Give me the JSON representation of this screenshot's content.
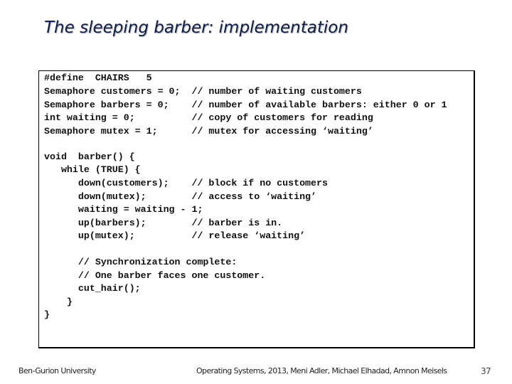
{
  "slide": {
    "title": "The sleeping barber: implementation",
    "code_lines": [
      "#define  CHAIRS   5",
      "Semaphore customers = 0;  // number of waiting customers",
      "Semaphore barbers = 0;    // number of available barbers: either 0 or 1",
      "int waiting = 0;          // copy of customers for reading",
      "Semaphore mutex = 1;      // mutex for accessing ‘waiting’",
      "",
      "void  barber() {",
      "   while (TRUE) {",
      "      down(customers);    // block if no customers",
      "      down(mutex);        // access to ‘waiting’",
      "      waiting = waiting - 1;",
      "      up(barbers);        // barber is in.",
      "      up(mutex);          // release ‘waiting’",
      "",
      "      // Synchronization complete:",
      "      // One barber faces one customer.",
      "      cut_hair();",
      "    }",
      "}"
    ],
    "footer": {
      "left": "Ben-Gurion University",
      "center": "Operating Systems, 2013, Meni Adler, Michael Elhadad, Amnon Meisels",
      "page_number": "37"
    }
  }
}
